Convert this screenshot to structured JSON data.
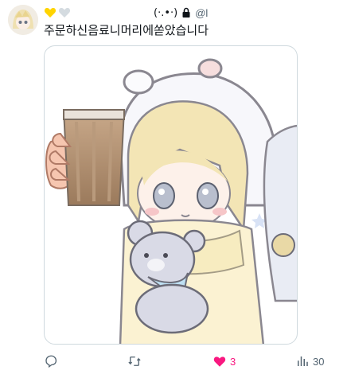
{
  "author": {
    "kaomoji": "(·.•·)",
    "handle": "@l",
    "heart_colors": [
      "#ffd400",
      "#cfd9de"
    ]
  },
  "tweet": {
    "text": "주문하신음료니머리에쏟았습니다"
  },
  "actions": {
    "reply": {
      "icon": "reply-icon",
      "count": ""
    },
    "retweet": {
      "icon": "retweet-icon",
      "count": ""
    },
    "like": {
      "icon": "heart-filled-icon",
      "count": "3",
      "color": "#f91880"
    },
    "views": {
      "icon": "views-icon",
      "count": "30"
    }
  }
}
